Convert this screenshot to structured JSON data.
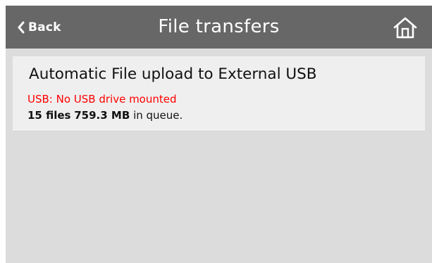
{
  "header": {
    "back_label": "Back",
    "title": "File transfers",
    "back_icon": "chevron-left-icon",
    "home_icon": "home-icon"
  },
  "upload_card": {
    "title": "Automatic File upload to External USB",
    "status": "USB: No USB drive mounted",
    "queue": {
      "files": "15 files",
      "size": "759.3 MB",
      "suffix": "in queue."
    }
  },
  "colors": {
    "header_bg": "#676767",
    "screen_bg": "#dcdcdc",
    "card_bg": "#efefef",
    "status_error": "#ff0000"
  }
}
